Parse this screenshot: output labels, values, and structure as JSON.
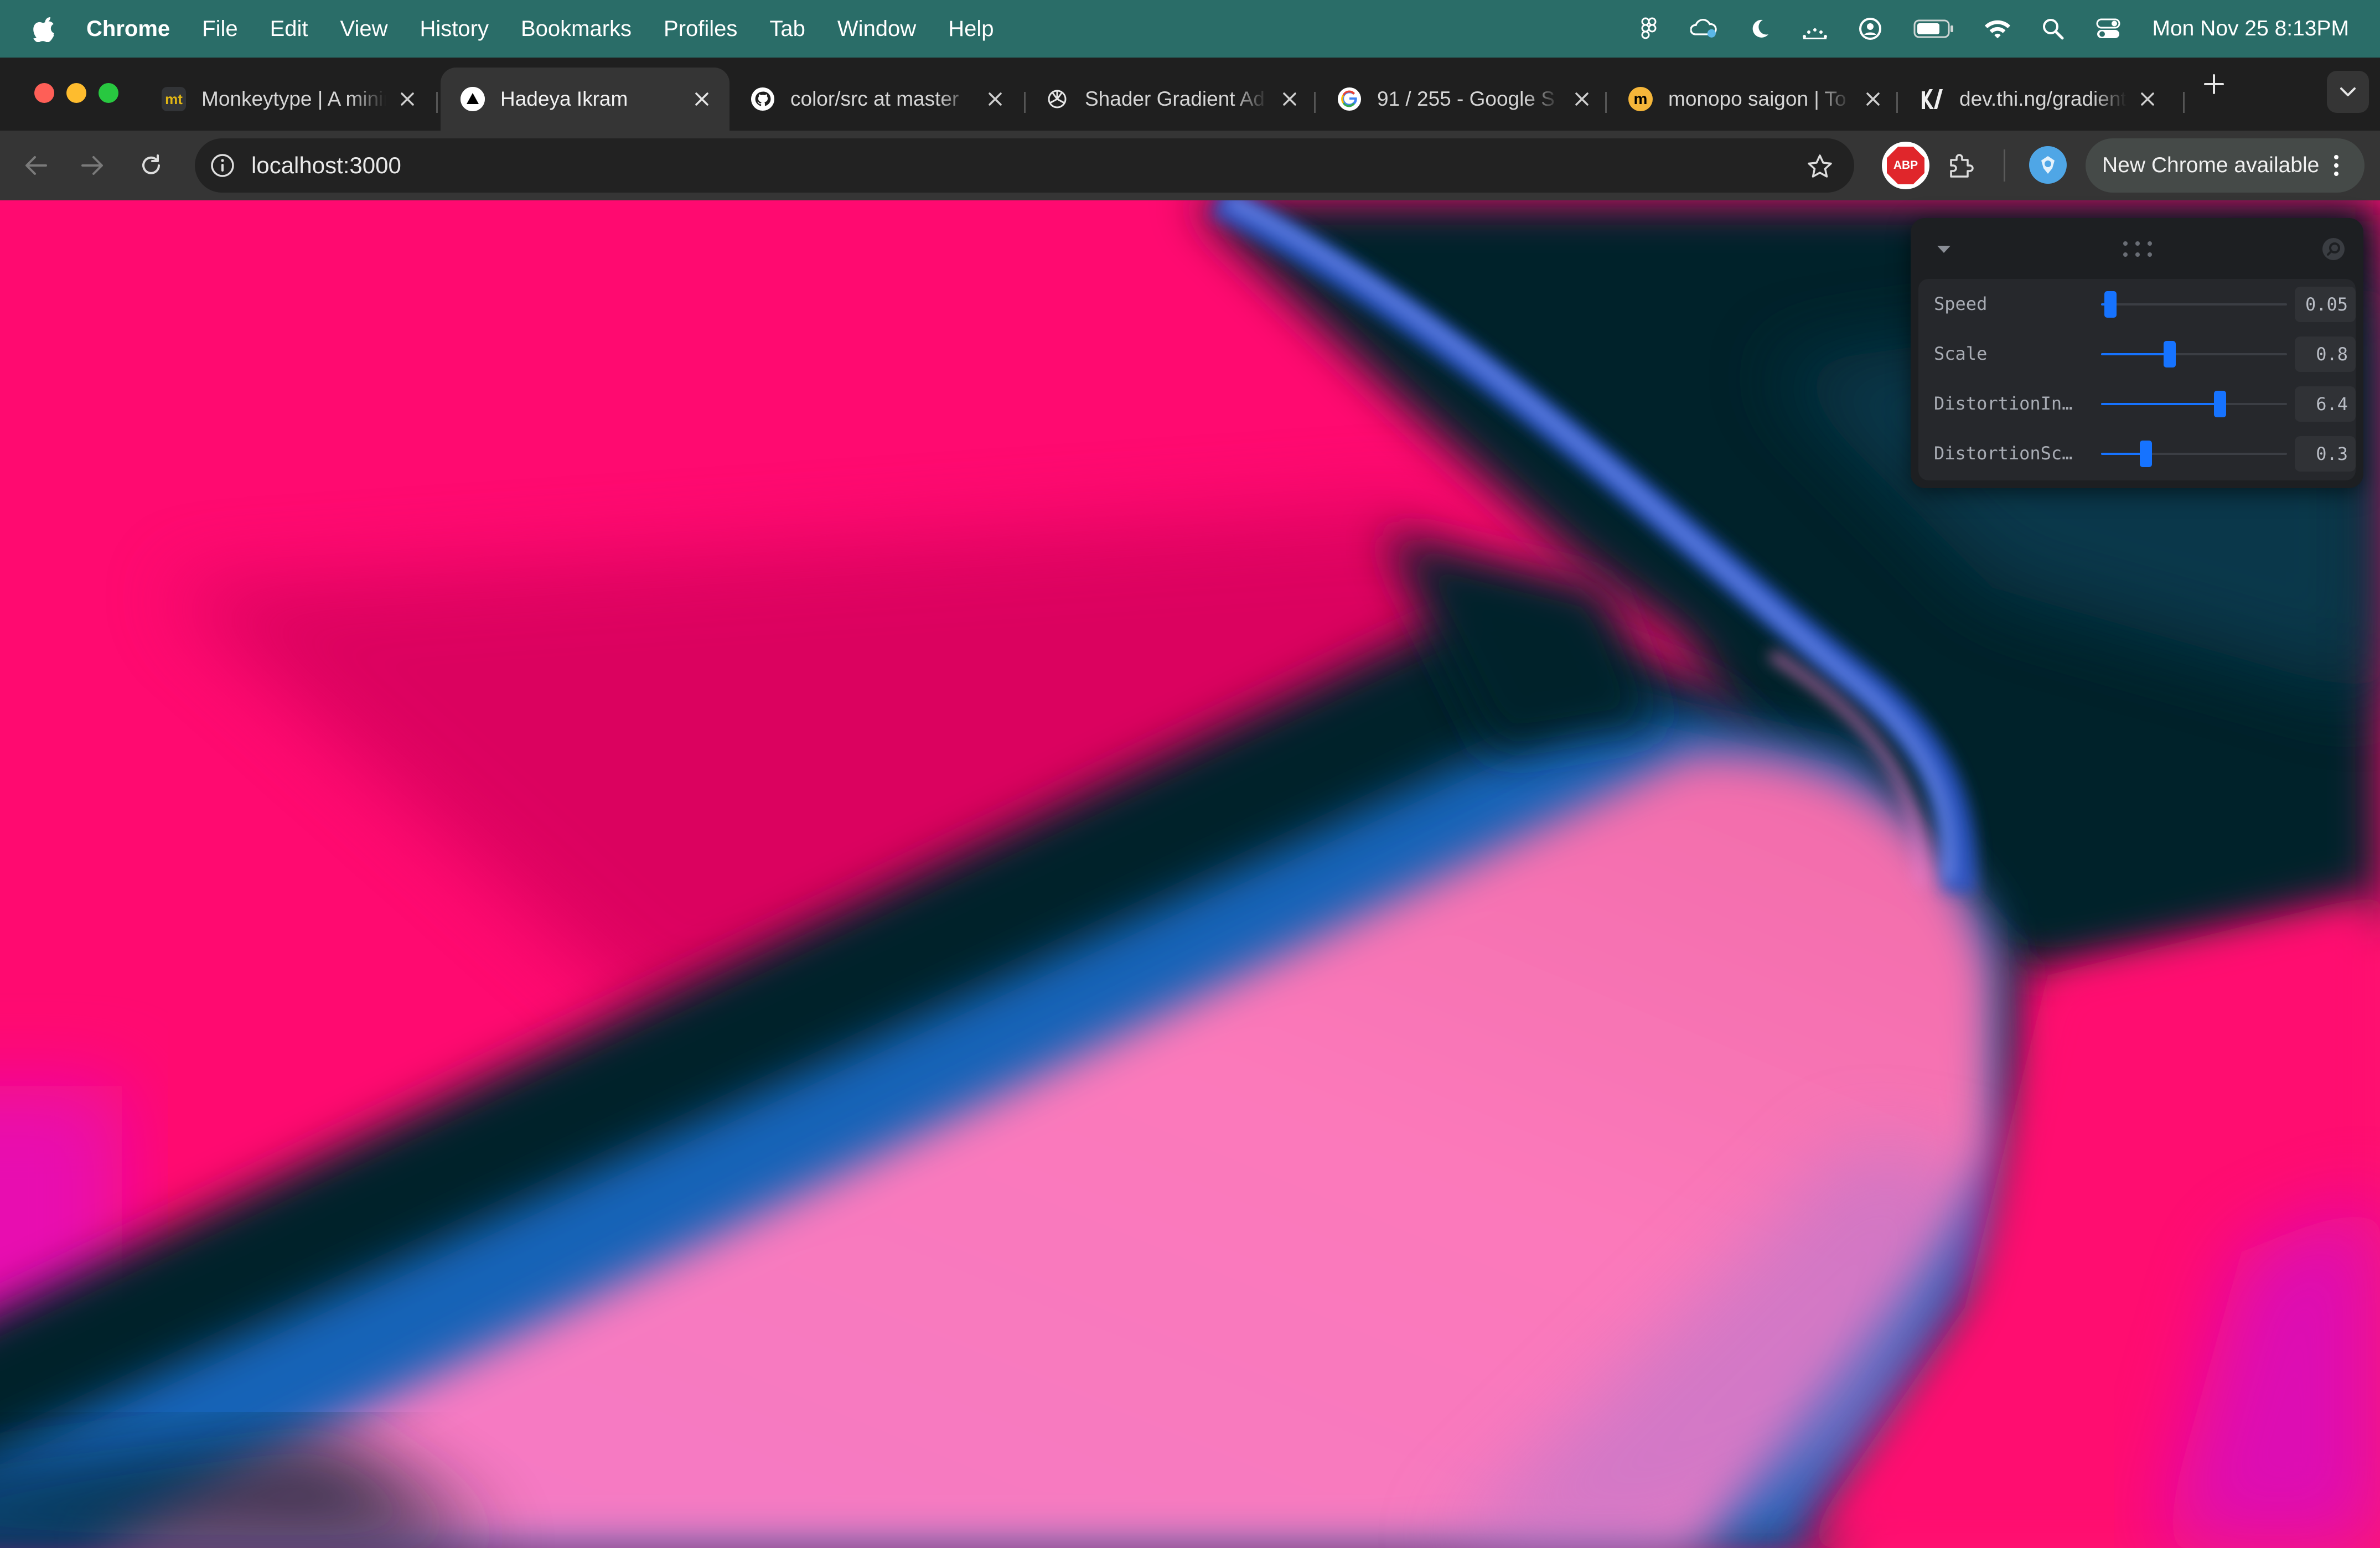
{
  "menubar": {
    "app_name": "Chrome",
    "items": [
      "File",
      "Edit",
      "View",
      "History",
      "Bookmarks",
      "Profiles",
      "Tab",
      "Window",
      "Help"
    ],
    "status_icons": [
      "figma-icon",
      "cloud-sync-icon",
      "moon-icon",
      "brightness-icon",
      "user-circle-icon",
      "battery-icon",
      "wifi-icon",
      "search-icon",
      "control-center-icon"
    ],
    "clock": "Mon Nov 25  8:13PM"
  },
  "tabs": [
    {
      "title": "Monkeytype | A minimalistic typing test",
      "favicon": "mt",
      "favicon_color": "#323437",
      "favicon_text_color": "#e2b714",
      "active": false
    },
    {
      "title": "Hadeya Ikram",
      "favicon": "triangle",
      "favicon_color": "#ffffff",
      "active": true
    },
    {
      "title": "color/src at master",
      "favicon": "github",
      "favicon_color": "#ffffff",
      "active": false
    },
    {
      "title": "Shader Gradient Ad",
      "favicon": "openai",
      "favicon_color": "#ffffff",
      "active": false
    },
    {
      "title": "91 / 255 - Google S",
      "favicon": "google",
      "favicon_color": "#ffffff",
      "active": false
    },
    {
      "title": "monopo saigon | To",
      "favicon": "m",
      "favicon_color": "#000000",
      "active": false
    },
    {
      "title": "dev.thi.ng/gradients",
      "favicon": "thing",
      "favicon_color": "#ffffff",
      "active": false
    }
  ],
  "toolbar": {
    "url": "localhost:3000",
    "update_label": "New Chrome available",
    "abp_label": "ABP"
  },
  "panel": {
    "controls": [
      {
        "label": "Speed",
        "value": "0.05",
        "fraction": 0.05
      },
      {
        "label": "Scale",
        "value": "0.8",
        "fraction": 0.37
      },
      {
        "label": "DistortionIntensity",
        "value": "6.4",
        "fraction": 0.64
      },
      {
        "label": "DistortionScale",
        "value": "0.3",
        "fraction": 0.24
      }
    ]
  },
  "colors": {
    "menubar": "#2a6d68",
    "accent": "#1673ff",
    "gradient_pink": "#ff0a70",
    "gradient_light_pink": "#f778bd",
    "gradient_blue": "#1863b7",
    "gradient_dark": "#03242b"
  }
}
